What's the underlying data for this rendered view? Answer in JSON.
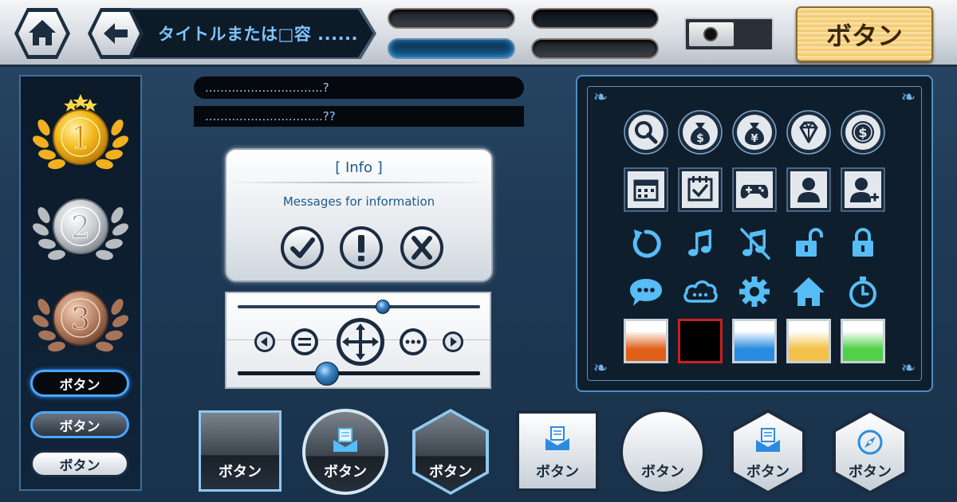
{
  "topbar": {
    "title": "タイトルまたは□容 ......",
    "main_button": "ボタン"
  },
  "left": {
    "medals": [
      "1",
      "2",
      "3"
    ],
    "buttons": [
      "ボタン",
      "ボタン",
      "ボタン"
    ]
  },
  "textbars": {
    "line1": "...............................?",
    "line2": "...............................??"
  },
  "dialog": {
    "title": "[ Info ]",
    "message": "Messages for information"
  },
  "sliders": {
    "top_value": 0.6,
    "bottom_value": 0.37
  },
  "icon_panel": {
    "row1": [
      "search-icon",
      "dollar-bag-icon",
      "yen-bag-icon",
      "diamond-icon",
      "coin-icon"
    ],
    "row2": [
      "calendar-icon",
      "calendar-check-icon",
      "gamepad-icon",
      "user-icon",
      "add-user-icon"
    ],
    "row3": [
      "refresh-icon",
      "music-icon",
      "music-muted-icon",
      "unlock-icon",
      "lock-icon"
    ],
    "row4": [
      "chat-icon",
      "cloud-icon",
      "gear-icon",
      "home-icon",
      "stopwatch-icon"
    ],
    "swatches": [
      "#e0601a",
      "#000000",
      "#2a8ce0",
      "#f2c24a",
      "#52d04a"
    ]
  },
  "bottom_buttons": [
    "ボタン",
    "ボタン",
    "ボタン",
    "ボタン",
    "ボタン",
    "ボタン",
    "ボタン"
  ],
  "colors": {
    "accent": "#4aa8ff",
    "gold": "#f6d488",
    "panel": "#0f1e2d"
  }
}
